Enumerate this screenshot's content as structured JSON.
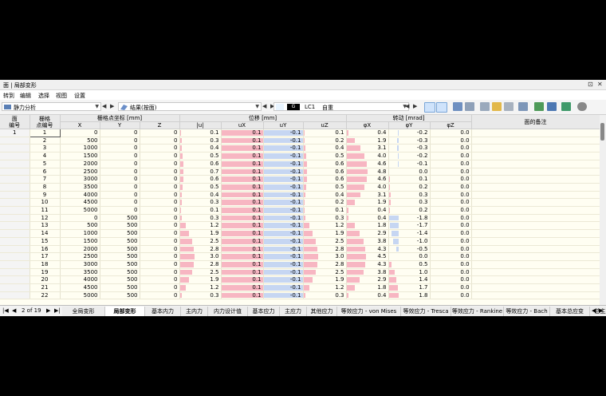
{
  "window": {
    "title": "面 | 局部变形",
    "pin_icon": "pin-icon",
    "close_icon": "close-icon"
  },
  "menu": [
    "转到",
    "编辑",
    "选择",
    "视图",
    "设置"
  ],
  "toolbar": {
    "analysis": "静力分析",
    "results": "结果(按面)",
    "lc_code": "G",
    "lc_id": "LC1",
    "lc_name": "自重"
  },
  "columns": {
    "face_no": "面\n编号",
    "grid_pt": "栅格\n点编号",
    "coords_group": "栅格点坐标 [mm]",
    "x": "X",
    "y": "Y",
    "z": "Z",
    "disp_group": "位移 [mm]",
    "u": "|u|",
    "ux": "uX",
    "uy": "uY",
    "uz": "uZ",
    "rot_group": "转动 [mrad]",
    "phx": "φX",
    "phy": "φY",
    "phz": "φZ",
    "comment": "面的备注"
  },
  "face_number": "1",
  "rows": [
    [
      "1",
      "0",
      "0",
      "0",
      "0.1",
      "0.1",
      "-0.1",
      "0.1",
      "0.4",
      "-0.2",
      "0.0"
    ],
    [
      "2",
      "500",
      "0",
      "0",
      "0.3",
      "0.1",
      "-0.1",
      "0.2",
      "1.9",
      "-0.3",
      "0.0"
    ],
    [
      "3",
      "1000",
      "0",
      "0",
      "0.4",
      "0.1",
      "-0.1",
      "0.4",
      "3.1",
      "-0.3",
      "0.0"
    ],
    [
      "4",
      "1500",
      "0",
      "0",
      "0.5",
      "0.1",
      "-0.1",
      "0.5",
      "4.0",
      "-0.2",
      "0.0"
    ],
    [
      "5",
      "2000",
      "0",
      "0",
      "0.6",
      "0.1",
      "-0.1",
      "0.6",
      "4.6",
      "-0.1",
      "0.0"
    ],
    [
      "6",
      "2500",
      "0",
      "0",
      "0.7",
      "0.1",
      "-0.1",
      "0.6",
      "4.8",
      "0.0",
      "0.0"
    ],
    [
      "7",
      "3000",
      "0",
      "0",
      "0.6",
      "0.1",
      "-0.1",
      "0.6",
      "4.6",
      "0.1",
      "0.0"
    ],
    [
      "8",
      "3500",
      "0",
      "0",
      "0.5",
      "0.1",
      "-0.1",
      "0.5",
      "4.0",
      "0.2",
      "0.0"
    ],
    [
      "9",
      "4000",
      "0",
      "0",
      "0.4",
      "0.1",
      "-0.1",
      "0.4",
      "3.1",
      "0.3",
      "0.0"
    ],
    [
      "10",
      "4500",
      "0",
      "0",
      "0.3",
      "0.1",
      "-0.1",
      "0.2",
      "1.9",
      "0.3",
      "0.0"
    ],
    [
      "11",
      "5000",
      "0",
      "0",
      "0.1",
      "0.1",
      "-0.1",
      "0.1",
      "0.4",
      "0.2",
      "0.0"
    ],
    [
      "12",
      "0",
      "500",
      "0",
      "0.3",
      "0.1",
      "-0.1",
      "0.3",
      "0.4",
      "-1.8",
      "0.0"
    ],
    [
      "13",
      "500",
      "500",
      "0",
      "1.2",
      "0.1",
      "-0.1",
      "1.2",
      "1.8",
      "-1.7",
      "0.0"
    ],
    [
      "14",
      "1000",
      "500",
      "0",
      "1.9",
      "0.1",
      "-0.1",
      "1.9",
      "2.9",
      "-1.4",
      "0.0"
    ],
    [
      "15",
      "1500",
      "500",
      "0",
      "2.5",
      "0.1",
      "-0.1",
      "2.5",
      "3.8",
      "-1.0",
      "0.0"
    ],
    [
      "16",
      "2000",
      "500",
      "0",
      "2.8",
      "0.1",
      "-0.1",
      "2.8",
      "4.3",
      "-0.5",
      "0.0"
    ],
    [
      "17",
      "2500",
      "500",
      "0",
      "3.0",
      "0.1",
      "-0.1",
      "3.0",
      "4.5",
      "0.0",
      "0.0"
    ],
    [
      "18",
      "3000",
      "500",
      "0",
      "2.8",
      "0.1",
      "-0.1",
      "2.8",
      "4.3",
      "0.5",
      "0.0"
    ],
    [
      "19",
      "3500",
      "500",
      "0",
      "2.5",
      "0.1",
      "-0.1",
      "2.5",
      "3.8",
      "1.0",
      "0.0"
    ],
    [
      "20",
      "4000",
      "500",
      "0",
      "1.9",
      "0.1",
      "-0.1",
      "1.9",
      "2.9",
      "1.4",
      "0.0"
    ],
    [
      "21",
      "4500",
      "500",
      "0",
      "1.2",
      "0.1",
      "-0.1",
      "1.2",
      "1.8",
      "1.7",
      "0.0"
    ],
    [
      "22",
      "5000",
      "500",
      "0",
      "0.3",
      "0.1",
      "-0.1",
      "0.3",
      "0.4",
      "1.8",
      "0.0"
    ]
  ],
  "pager": {
    "text": "2 of 19"
  },
  "tabs": [
    "全局变形",
    "局部变形",
    "基本内力",
    "主内力",
    "内力设计值",
    "基本应力",
    "主应力",
    "其他应力",
    "等效应力 - von Mises",
    "等效应力 - Tresca",
    "等效应力 - Rankine",
    "等效应力 - Bach",
    "基本总应变",
    "总主应变"
  ],
  "active_tab": 1,
  "colors": {
    "header_bg": "#e9e9e9",
    "row_bg": "#fffef2",
    "pos_bar": "#f7b6c2",
    "neg_bar": "#c6d6f2"
  }
}
